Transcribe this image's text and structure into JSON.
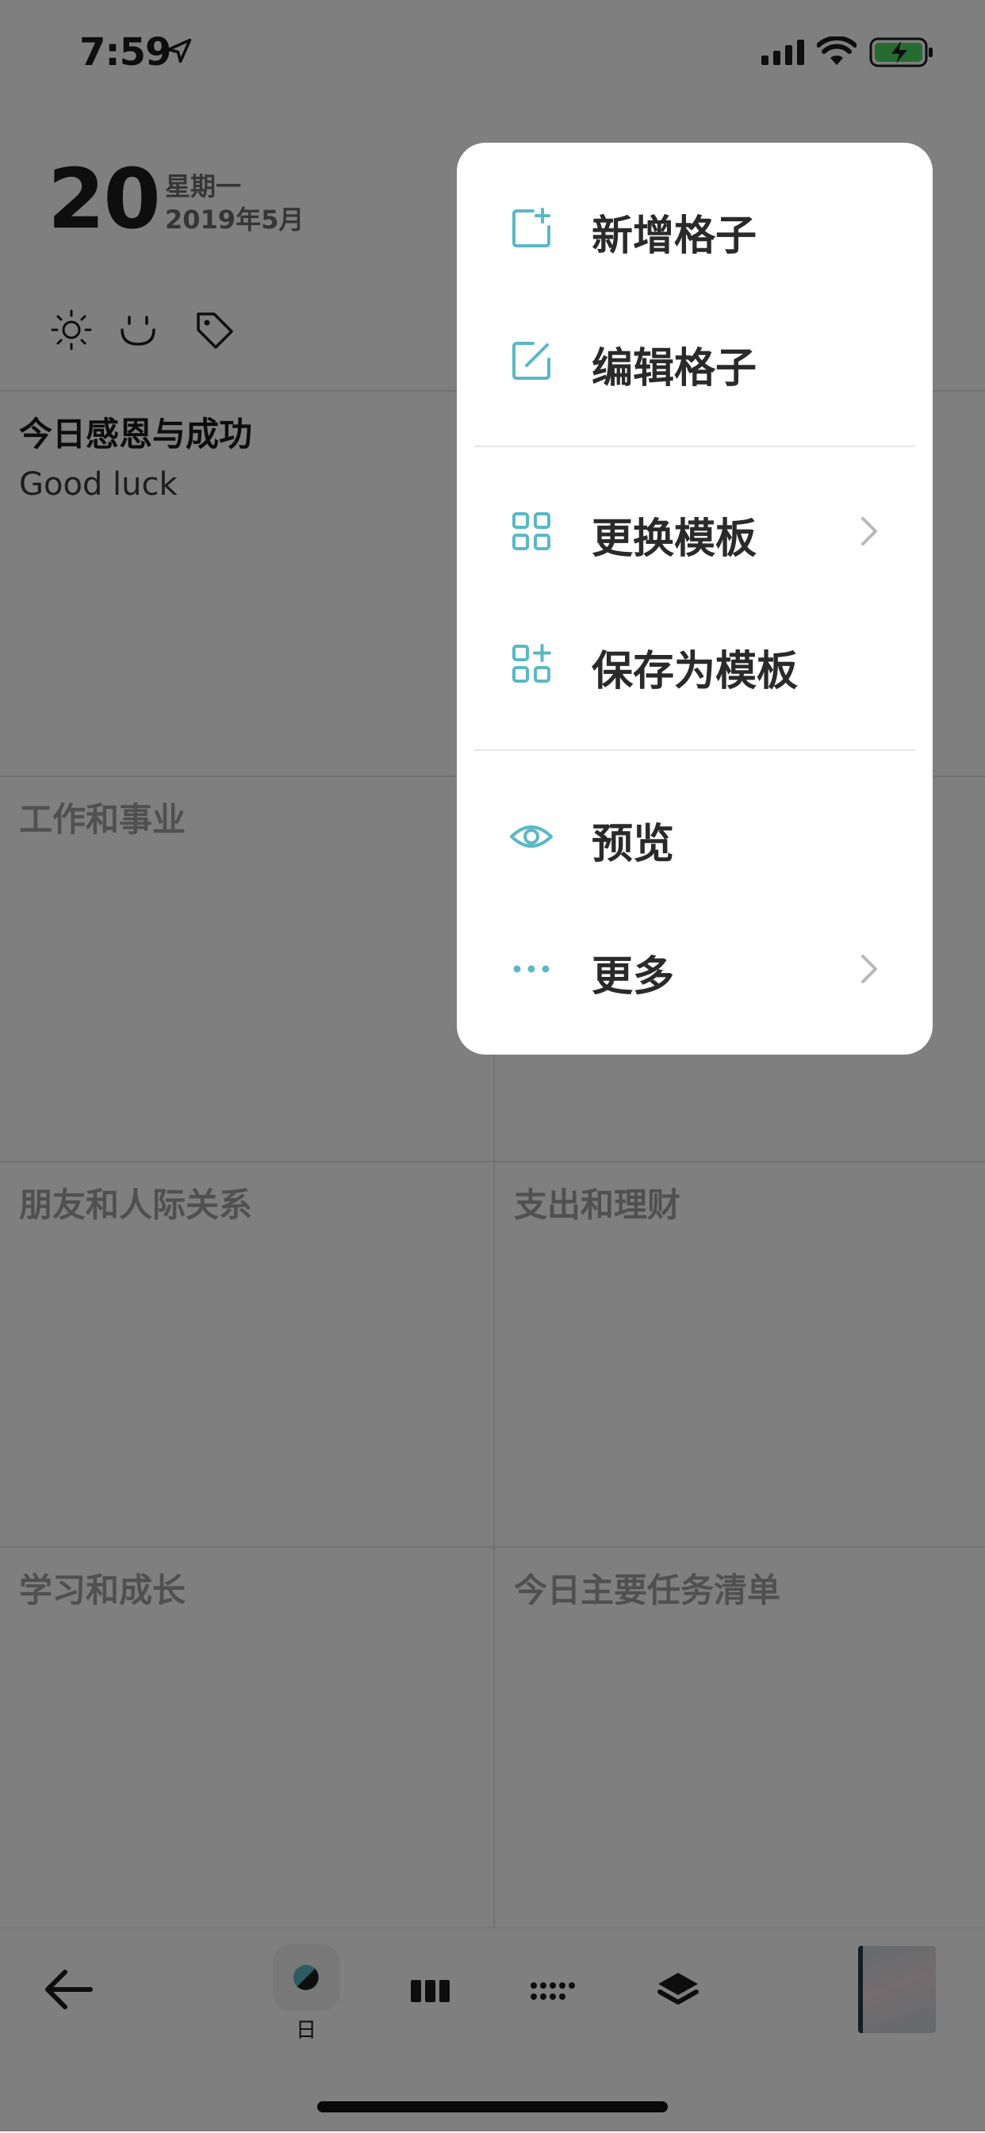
{
  "status_bar": {
    "time": "7:59"
  },
  "header": {
    "day": "20",
    "weekday": "星期一",
    "year_month": "2019年5月"
  },
  "cells": [
    {
      "title": "今日感恩与成功",
      "content": "Good luck"
    },
    {
      "title": "工作和事业",
      "content": ""
    },
    {
      "title": "朋友和人际关系",
      "content": ""
    },
    {
      "title": "支出和理财",
      "content": ""
    },
    {
      "title": "学习和成长",
      "content": ""
    },
    {
      "title": "今日主要任务清单",
      "content": ""
    }
  ],
  "menu": {
    "items": [
      {
        "label": "新增格子",
        "icon": "add-box-icon"
      },
      {
        "label": "编辑格子",
        "icon": "edit-box-icon"
      },
      {
        "label": "更换模板",
        "icon": "grid-icon",
        "has_submenu": true
      },
      {
        "label": "保存为模板",
        "icon": "grid-add-icon"
      },
      {
        "label": "预览",
        "icon": "eye-icon"
      },
      {
        "label": "更多",
        "icon": "more-dots-icon",
        "has_submenu": true
      }
    ]
  },
  "bottom_nav": {
    "day_tab_label": "日"
  },
  "colors": {
    "accent": "#5bb8c4",
    "overlay": "rgba(0,0,0,0.5)"
  }
}
